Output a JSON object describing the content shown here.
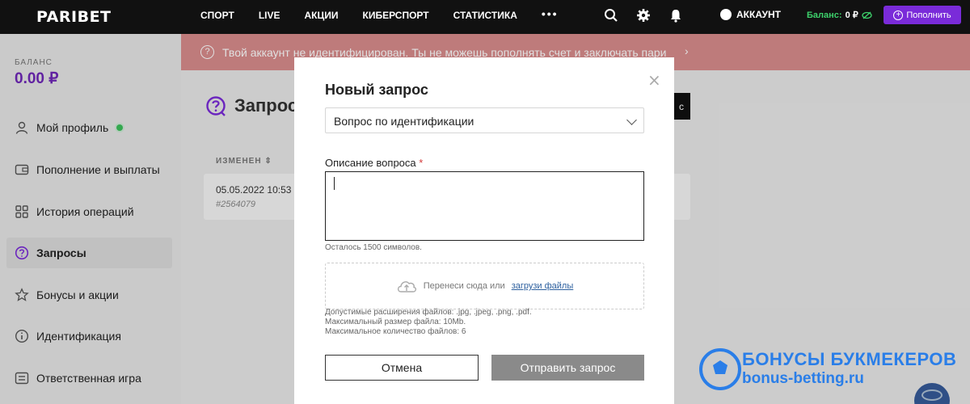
{
  "header": {
    "logo": "PARIBET",
    "nav": [
      "СПОРТ",
      "LIVE",
      "АКЦИИ",
      "КИБЕРСПОРТ",
      "СТАТИСТИКА"
    ],
    "more": "•••",
    "account": "АККАУНТ",
    "balance_label": "Баланс:",
    "balance_value": "0 ₽",
    "topup": "Пополнить"
  },
  "sidebar": {
    "balance_label": "БАЛАНС",
    "balance_value": "0.00 ₽",
    "items": [
      {
        "label": "Мой профиль",
        "icon": "user-icon"
      },
      {
        "label": "Пополнение и выплаты",
        "icon": "wallet-icon"
      },
      {
        "label": "История операций",
        "icon": "grid-icon"
      },
      {
        "label": "Запросы",
        "icon": "question-icon"
      },
      {
        "label": "Бонусы и акции",
        "icon": "star-icon"
      },
      {
        "label": "Идентификация",
        "icon": "info-icon"
      },
      {
        "label": "Ответственная игра",
        "icon": "sliders-icon"
      }
    ]
  },
  "main": {
    "banner": "Твой аккаунт не идентифицирован. Ты не можешь пополнять счет и заключать пари",
    "banner_icon": "?",
    "title": "Запрос",
    "dark_button": "с",
    "column_header": "ИЗМЕНЕН",
    "row": {
      "date": "05.05.2022 10:53",
      "id": "#2564079"
    }
  },
  "modal": {
    "title": "Новый запрос",
    "select_value": "Вопрос по идентификации",
    "description_label": "Описание вопроса",
    "required_mark": "*",
    "remaining": "Осталось 1500 символов.",
    "dropzone_text": "Перенеси сюда или",
    "dropzone_link": "загрузи файлы",
    "limits": [
      "Допустимые расширения файлов: .jpg, .jpeg, .png, .pdf.",
      "Максимальный размер файла: 10Mb.",
      "Максимальное количество файлов: 6"
    ],
    "cancel": "Отмена",
    "submit": "Отправить запрос"
  },
  "watermark": {
    "line1": "БОНУСЫ БУКМЕКЕРОВ",
    "line2": "bonus-betting.ru"
  },
  "colors": {
    "accent": "#7a2bd9",
    "balance": "#6f27b8",
    "banner": "#d98c8c",
    "green": "#3dd16b"
  }
}
